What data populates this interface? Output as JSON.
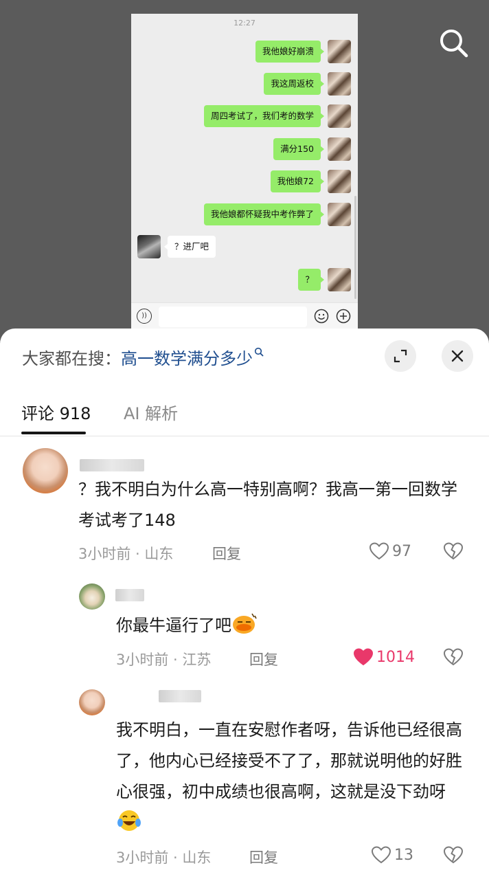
{
  "chat": {
    "time": "12:27",
    "messages": [
      {
        "side": "me",
        "text": "我他娘好崩溃"
      },
      {
        "side": "me",
        "text": "我这周返校"
      },
      {
        "side": "me",
        "text": "周四考试了，我们考的数学"
      },
      {
        "side": "me",
        "text": "满分150"
      },
      {
        "side": "me",
        "text": "我他娘72"
      },
      {
        "side": "me",
        "text": "我他娘都怀疑我中考作弊了"
      },
      {
        "side": "them",
        "text": "？进厂吧"
      },
      {
        "side": "me",
        "text": "？"
      }
    ]
  },
  "sheet": {
    "search_prefix": "大家都在搜：",
    "search_query": "高一数学满分多少",
    "tabs": {
      "comments_label": "评论",
      "comments_count": "918",
      "ai_label": "AI 解析"
    }
  },
  "comments": [
    {
      "text": "？我不明白为什么高一特别高啊？我高一第一回数学考试考了148",
      "time": "3小时前",
      "location": "山东",
      "reply_label": "回复",
      "likes": "97",
      "liked": false
    },
    {
      "text": "你最牛逼行了吧",
      "time": "3小时前",
      "location": "江苏",
      "reply_label": "回复",
      "likes": "1014",
      "liked": true
    },
    {
      "text": "我不明白，一直在安慰作者呀，告诉他已经很高了，他内心已经接受不了了，那就说明他的好胜心很强，初中成绩也很高啊，这就是没下劲呀",
      "time": "3小时前",
      "location": "山东",
      "reply_label": "回复",
      "likes": "13",
      "liked": false
    }
  ],
  "colors": {
    "wechat_green": "#95ec69",
    "like_red": "#e9386a",
    "link_blue": "#1f4e8f"
  }
}
